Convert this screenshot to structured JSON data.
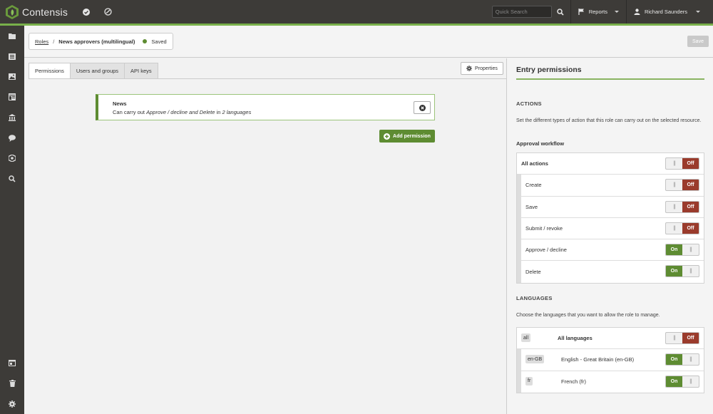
{
  "topbar": {
    "brand": "Contensis",
    "search_placeholder": "Quick Search",
    "reports_label": "Reports",
    "user_label": "Richard Saunders"
  },
  "sidebar": {
    "items": [
      "folder-icon",
      "entries-icon",
      "image-icon",
      "layout-icon",
      "institution-icon",
      "comment-icon",
      "block-icon",
      "search-icon"
    ],
    "bottom_items": [
      "browser-window-icon",
      "trash-icon",
      "gear-icon"
    ]
  },
  "header": {
    "breadcrumb_root": "Roles",
    "breadcrumb_separator": "/",
    "breadcrumb_current": "News approvers (multilingual)",
    "status": "Saved",
    "status_color": "#5e8c32",
    "save_label": "Save"
  },
  "main": {
    "tabs": [
      {
        "label": "Permissions",
        "active": true
      },
      {
        "label": "Users and groups",
        "active": false
      },
      {
        "label": "API keys",
        "active": false
      }
    ],
    "properties_label": "Properties",
    "permission": {
      "title": "News",
      "desc_prefix": "Can carry out ",
      "desc_actions": "Approve / decline and Delete",
      "desc_middle": " in ",
      "desc_langs": "2 languages"
    },
    "add_permission_label": "Add permission"
  },
  "panel": {
    "title": "Entry permissions",
    "actions_heading": "ACTIONS",
    "actions_desc": "Set the different types of action that this role can carry out on the selected resource.",
    "workflow_label": "Approval workflow",
    "all_actions": {
      "label": "All actions",
      "state": "Off"
    },
    "actions": [
      {
        "label": "Create",
        "state": "Off"
      },
      {
        "label": "Save",
        "state": "Off"
      },
      {
        "label": "Submit / revoke",
        "state": "Off"
      },
      {
        "label": "Approve / decline",
        "state": "On"
      },
      {
        "label": "Delete",
        "state": "On"
      }
    ],
    "languages_heading": "LANGUAGES",
    "languages_desc": "Choose the languages that you want to allow the role to manage.",
    "all_languages": {
      "code": "all",
      "label": "All languages",
      "state": "Off"
    },
    "languages": [
      {
        "code": "en-GB",
        "label": "English - Great Britain (en-GB)",
        "state": "On"
      },
      {
        "code": "fr",
        "label": "French (fr)",
        "state": "On"
      }
    ],
    "on_color": "#5e8c32",
    "off_color": "#9a3b2c",
    "grip": "|||"
  }
}
